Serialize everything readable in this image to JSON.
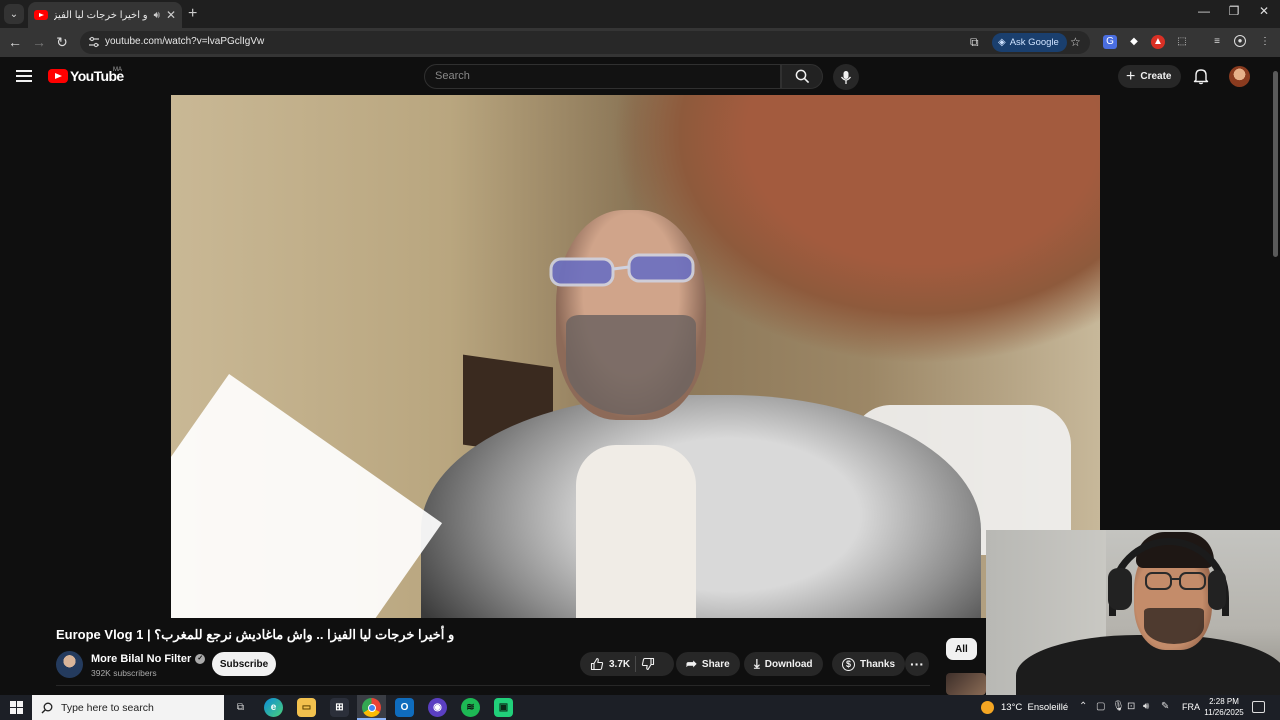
{
  "browser": {
    "tab_title": "و أخيرا خرجات ليا الفيزا .. واش",
    "url": "youtube.com/watch?v=lvaPGclIgVw",
    "ask_google_label": "Ask Google",
    "accent_color": "#8ab4f8"
  },
  "youtube": {
    "logo_text": "YouTube",
    "region": "MA",
    "search_placeholder": "Search",
    "create_label": "Create",
    "brand_color": "#ff0000"
  },
  "video": {
    "title": "Europe Vlog 1 | و أخيرا خرجات ليا الفيزا .. واش ماغاديش نرجع للمغرب؟",
    "channel_name": "More Bilal No Filter",
    "subscribers": "392K subscribers",
    "subscribe_label": "Subscribe",
    "likes": "3.7K",
    "share_label": "Share",
    "download_label": "Download",
    "thanks_label": "Thanks"
  },
  "recommendations": {
    "chip_all": "All"
  },
  "taskbar": {
    "search_placeholder": "Type here to search",
    "temperature": "13°C",
    "weather": "Ensoleillé",
    "language": "FRA",
    "time": "2:28 PM",
    "date": "11/26/2025"
  }
}
